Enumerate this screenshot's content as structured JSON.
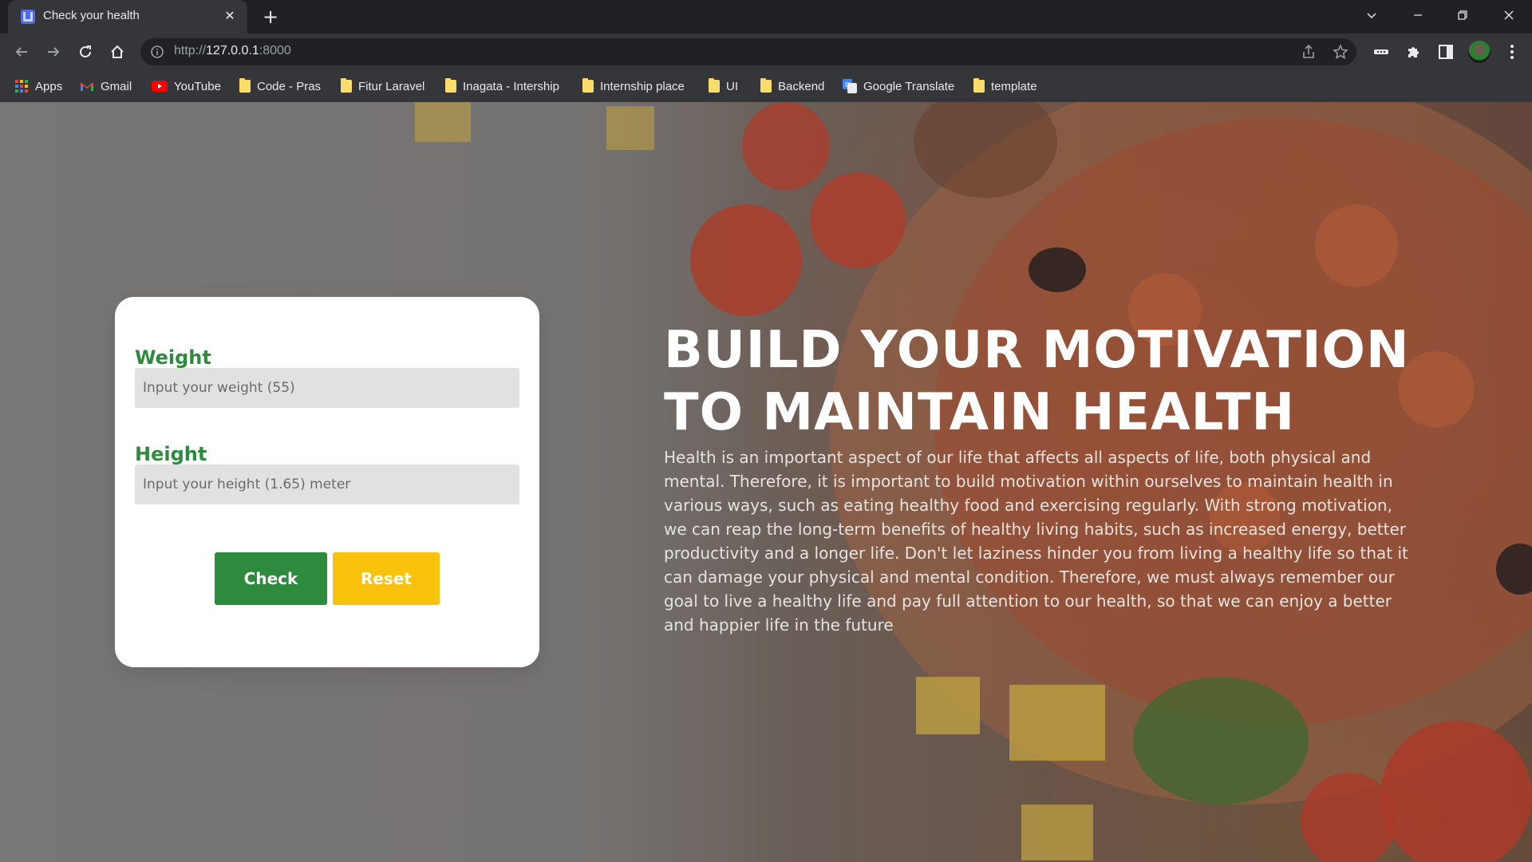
{
  "browser": {
    "tab_title": "Check your health",
    "url_scheme": "http://",
    "url_host": "127.0.0.1",
    "url_port": ":8000"
  },
  "bookmarks": [
    {
      "label": "Apps",
      "icon": "apps-grid-icon"
    },
    {
      "label": "Gmail",
      "icon": "gmail-icon"
    },
    {
      "label": "YouTube",
      "icon": "youtube-icon"
    },
    {
      "label": "Code - Pras",
      "icon": "folder-icon"
    },
    {
      "label": "Fitur Laravel",
      "icon": "folder-icon"
    },
    {
      "label": "Inagata - Intership",
      "icon": "folder-icon"
    },
    {
      "label": "Internship place",
      "icon": "folder-icon"
    },
    {
      "label": "UI",
      "icon": "folder-icon"
    },
    {
      "label": "Backend",
      "icon": "folder-icon"
    },
    {
      "label": "Google Translate",
      "icon": "google-translate-icon"
    },
    {
      "label": "template",
      "icon": "folder-icon"
    }
  ],
  "form": {
    "weight_label": "Weight",
    "weight_placeholder": "Input your weight (55)",
    "height_label": "Height",
    "height_placeholder": "Input your height (1.65) meter",
    "check_label": "Check",
    "reset_label": "Reset"
  },
  "hero": {
    "title_line1": "BUILD YOUR MOTIVATION",
    "title_line2": "TO MAINTAIN HEALTH",
    "body": "Health is an important aspect of our life that affects all aspects of life, both physical and mental. Therefore, it is important to build motivation within ourselves to maintain health in various ways, such as eating healthy food and exercising regularly. With strong motivation, we can reap the long-term benefits of healthy living habits, such as increased energy, better productivity and a longer life. Don't let laziness hinder you from living a healthy life so that it can damage your physical and mental condition. Therefore, we must always remember our goal to live a healthy life and pay full attention to our health, so that we can enjoy a better and happier life in the future"
  },
  "colors": {
    "accent_green": "#2e8b3e",
    "accent_yellow": "#f8c10b",
    "chrome_dark": "#202124",
    "chrome_toolbar": "#35363a"
  }
}
